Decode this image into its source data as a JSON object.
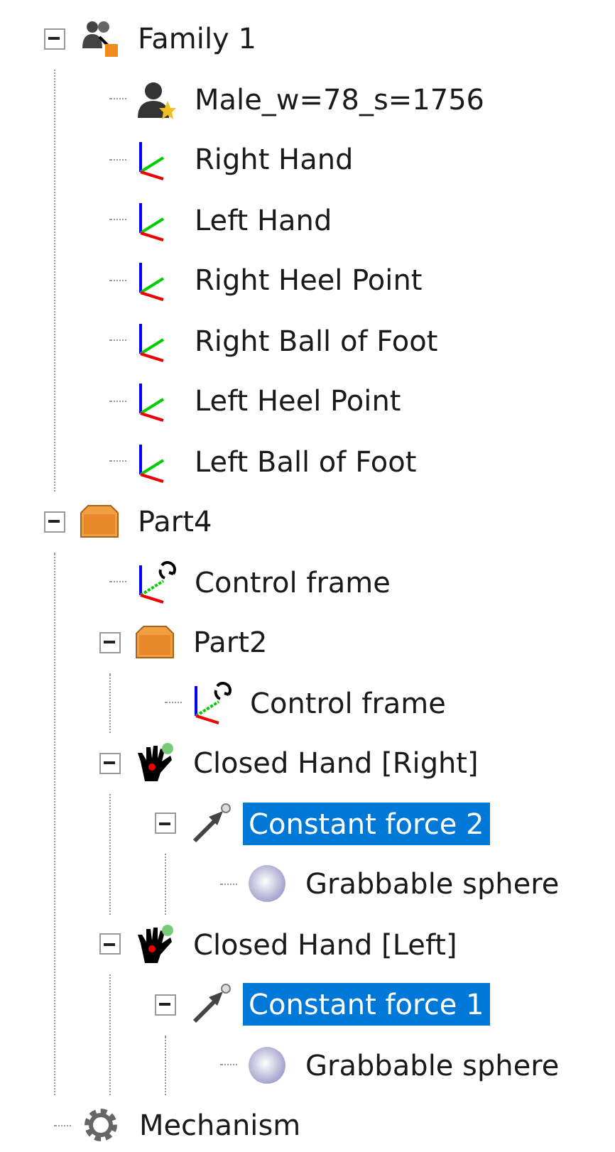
{
  "tree": [
    {
      "kind": "family",
      "label": "Family 1",
      "expanded": true,
      "selected": false,
      "children": [
        {
          "kind": "human",
          "label": "Male_w=78_s=1756",
          "selected": false
        },
        {
          "kind": "frame",
          "label": "Right Hand",
          "selected": false
        },
        {
          "kind": "frame",
          "label": "Left Hand",
          "selected": false
        },
        {
          "kind": "frame",
          "label": "Right Heel Point",
          "selected": false
        },
        {
          "kind": "frame",
          "label": "Right Ball of Foot",
          "selected": false
        },
        {
          "kind": "frame",
          "label": "Left Heel Point",
          "selected": false
        },
        {
          "kind": "frame",
          "label": "Left Ball of Foot",
          "selected": false
        }
      ]
    },
    {
      "kind": "part",
      "label": "Part4",
      "expanded": true,
      "selected": false,
      "children": [
        {
          "kind": "control_frame",
          "label": "Control frame",
          "selected": false
        },
        {
          "kind": "part",
          "label": "Part2",
          "expanded": true,
          "selected": false,
          "children": [
            {
              "kind": "control_frame",
              "label": "Control frame",
              "selected": false
            }
          ]
        },
        {
          "kind": "hand",
          "label": "Closed Hand [Right]",
          "expanded": true,
          "selected": false,
          "children": [
            {
              "kind": "force",
              "label": "Constant force 2",
              "expanded": true,
              "selected": true,
              "children": [
                {
                  "kind": "sphere",
                  "label": "Grabbable sphere",
                  "selected": false
                }
              ]
            }
          ]
        },
        {
          "kind": "hand",
          "label": "Closed Hand [Left]",
          "expanded": true,
          "selected": false,
          "children": [
            {
              "kind": "force",
              "label": "Constant force 1",
              "expanded": true,
              "selected": true,
              "children": [
                {
                  "kind": "sphere",
                  "label": "Grabbable sphere",
                  "selected": false
                }
              ]
            }
          ]
        }
      ]
    },
    {
      "kind": "mechanism",
      "label": "Mechanism",
      "selected": false
    }
  ]
}
